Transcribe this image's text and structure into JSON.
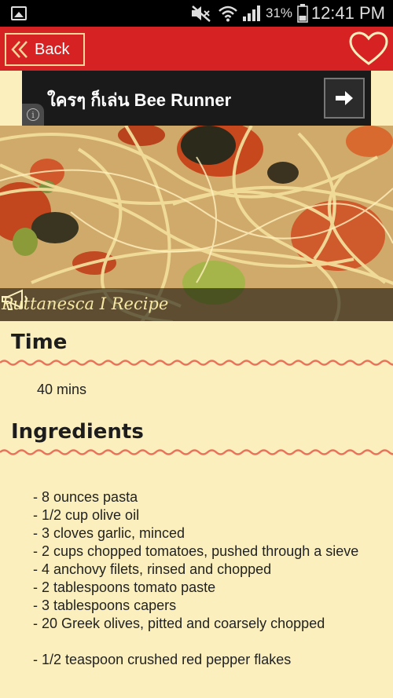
{
  "status_bar": {
    "battery": "31%",
    "time": "12:41 PM"
  },
  "app_bar": {
    "back_label": "Back"
  },
  "ad": {
    "text": "ใครๆ ก็เล่น Bee Runner"
  },
  "hero": {
    "title": "Puttanesca I Recipe"
  },
  "time_section": {
    "heading": "Time",
    "value": "40 mins"
  },
  "ingredients_section": {
    "heading": "Ingredients",
    "items": [
      "-  8 ounces pasta",
      "-  1/2 cup olive oil",
      "-  3 cloves garlic, minced",
      "-  2 cups chopped tomatoes, pushed through a sieve",
      "-  4 anchovy filets, rinsed and chopped",
      "-  2 tablespoons tomato paste",
      "-  3 tablespoons capers",
      "-  20 Greek olives, pitted and coarsely chopped",
      "-  1/2 teaspoon crushed red pepper flakes"
    ]
  },
  "colors": {
    "app_bar": "#d62222",
    "background": "#fbefbd",
    "wave": "#e8735a"
  }
}
